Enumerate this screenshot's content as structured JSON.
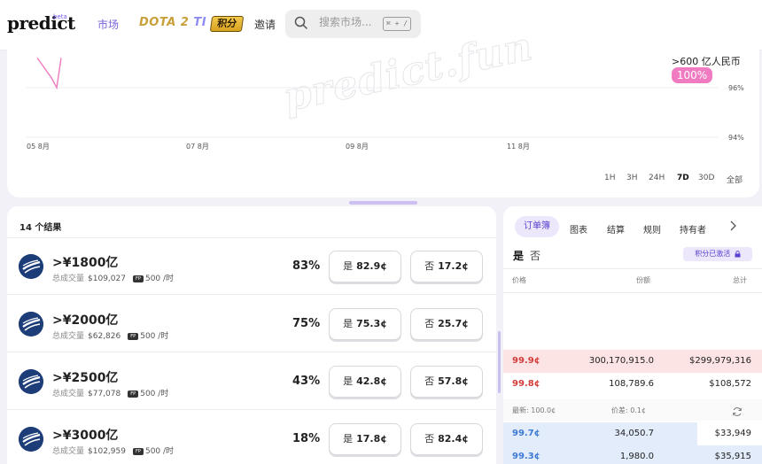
{
  "nav": {
    "logo": "predict",
    "beta": "beta",
    "markets": "市场",
    "dota": "DOTA 2",
    "ti": "TI",
    "points": "积分",
    "invite": "邀请",
    "search_placeholder": "搜索市场...",
    "shortcut": "⌘ + /"
  },
  "chart": {
    "watermark": "predict.fun",
    "value_label": ">600 亿人民币",
    "value_pct": "100%",
    "ranges": [
      "1H",
      "3H",
      "24H",
      "7D",
      "30D",
      "全部"
    ],
    "active_range": "7D"
  },
  "chart_data": {
    "type": "line",
    "x_ticks": [
      "05 8月",
      "07 8月",
      "09 8月",
      "11 8月"
    ],
    "y_ticks": [
      "96%",
      "94%"
    ],
    "series": [
      {
        "values": [
          97.2,
          96.4,
          96.0,
          97.2
        ]
      }
    ],
    "line_color": "#f07bc0"
  },
  "results": {
    "count_label": "14 个结果",
    "volume_label": "总成交量",
    "points_label": "500 /时",
    "yes_label": "是",
    "no_label": "否",
    "rows": [
      {
        "title": ">¥1800亿",
        "volume": "$109,027",
        "pct": "83%",
        "yes": "82.9¢",
        "no": "17.2¢"
      },
      {
        "title": ">¥2000亿",
        "volume": "$62,826",
        "pct": "75%",
        "yes": "75.3¢",
        "no": "25.7¢"
      },
      {
        "title": ">¥2500亿",
        "volume": "$77,078",
        "pct": "43%",
        "yes": "42.8¢",
        "no": "57.8¢"
      },
      {
        "title": ">¥3000亿",
        "volume": "$102,959",
        "pct": "18%",
        "yes": "17.8¢",
        "no": "82.4¢"
      }
    ]
  },
  "orderbook": {
    "tabs": [
      "订单簿",
      "图表",
      "结算",
      "规则",
      "持有者"
    ],
    "yes": "是",
    "no": "否",
    "points_active": "积分已激活",
    "headers": {
      "price": "价格",
      "shares": "份额",
      "total": "总计"
    },
    "asks": [
      {
        "price": "99.9¢",
        "shares": "300,170,915.0",
        "total": "$299,979,316"
      },
      {
        "price": "99.8¢",
        "shares": "108,789.6",
        "total": "$108,572"
      }
    ],
    "last": "最新: 100.0¢",
    "spread": "价差: 0.1¢",
    "bids": [
      {
        "price": "99.7¢",
        "shares": "34,050.7",
        "total": "$33,949"
      },
      {
        "price": "99.3¢",
        "shares": "1,980.0",
        "total": "$35,915"
      }
    ],
    "colors": {
      "ask_bg": "#fde4e4",
      "bid_bg": "#e3ecfb"
    }
  }
}
